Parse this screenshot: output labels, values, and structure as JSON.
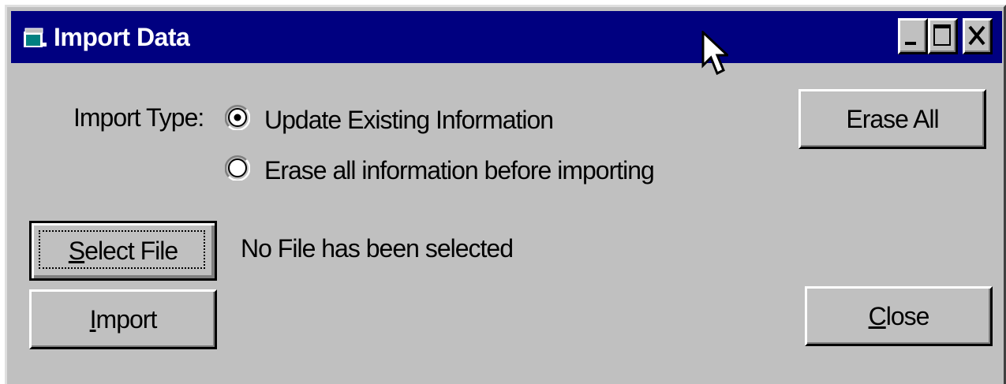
{
  "window": {
    "title": "Import Data",
    "icon": "app-window-icon",
    "controls": {
      "minimize_icon": "minimize-icon",
      "maximize_icon": "maximize-icon",
      "close_icon": "close-icon"
    }
  },
  "import_type": {
    "label": "Import Type:",
    "options": [
      {
        "label": "Update Existing Information",
        "selected": true
      },
      {
        "label": "Erase all information before importing",
        "selected": false
      }
    ]
  },
  "buttons": {
    "erase_all": "Erase All",
    "select_file_accel": "S",
    "select_file_rest": "elect File",
    "import_accel": "I",
    "import_rest": "mport",
    "close_accel": "C",
    "close_rest": "lose"
  },
  "file_status": "No File has been selected",
  "colors": {
    "titlebar": "#000080",
    "window_face": "#c0c0c0",
    "title_text": "#ffffff"
  }
}
